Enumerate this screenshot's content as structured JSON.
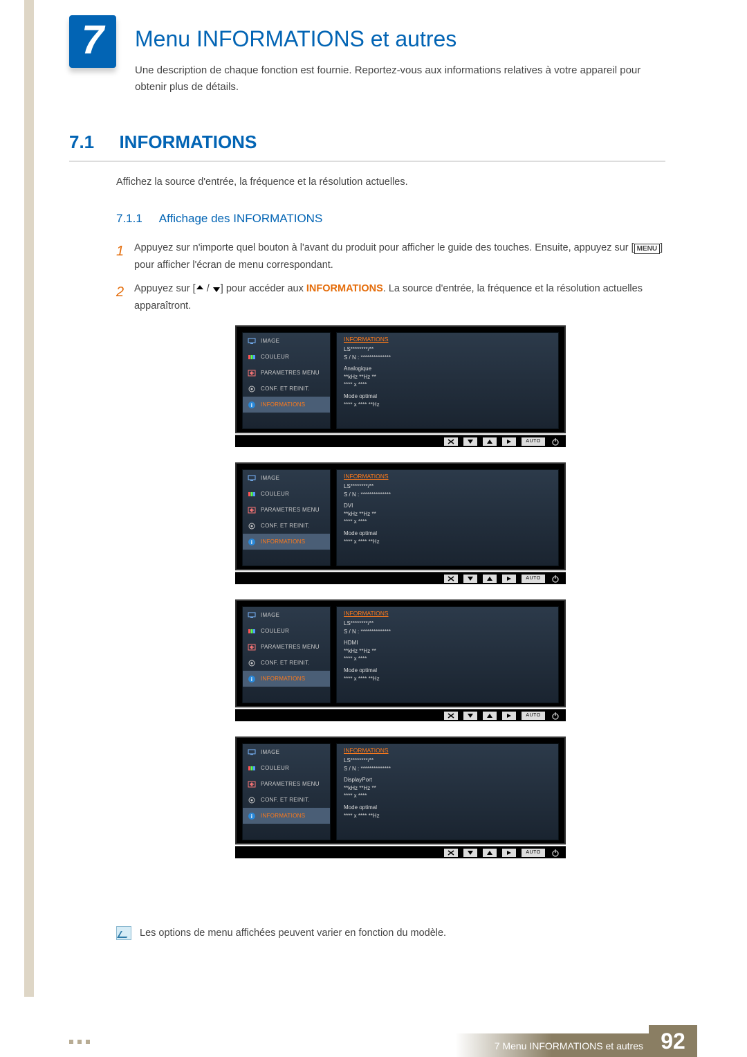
{
  "chapter": {
    "number": "7",
    "title": "Menu INFORMATIONS et autres",
    "description": "Une description de chaque fonction est fournie. Reportez-vous aux informations relatives à votre appareil pour obtenir plus de détails."
  },
  "section": {
    "number": "7.1",
    "title": "INFORMATIONS",
    "text": "Affichez la source d'entrée, la fréquence et la résolution actuelles."
  },
  "subsection": {
    "number": "7.1.1",
    "title": "Affichage des INFORMATIONS"
  },
  "steps": {
    "s1_num": "1",
    "s1_a": "Appuyez sur n'importe quel bouton à l'avant du produit pour afficher le guide des touches. Ensuite, appuyez sur [",
    "s1_menu": "MENU",
    "s1_b": "] pour afficher l'écran de menu correspondant.",
    "s2_num": "2",
    "s2_a": "Appuyez sur [",
    "s2_b": "] pour accéder aux ",
    "s2_hl": "INFORMATIONS",
    "s2_c": ". La source d'entrée, la fréquence et la résolution actuelles apparaîtront."
  },
  "osd_menu": {
    "items": [
      "IMAGE",
      "COULEUR",
      "PARAMETRES MENU",
      "CONF. ET REINIT.",
      "INFORMATIONS"
    ],
    "selected_index": 4,
    "panel_title": "INFORMATIONS",
    "model": "LS********/**",
    "serial": "S / N : **************",
    "freq": "**kHz **Hz **",
    "res": "**** x ****",
    "optimal_label": "Mode optimal",
    "optimal_value": "**** x **** **Hz",
    "bar": {
      "auto": "AUTO"
    }
  },
  "osd_sources": [
    "Analogique",
    "DVI",
    "HDMI",
    "DisplayPort"
  ],
  "note": "Les options de menu affichées peuvent varier en fonction du modèle.",
  "footer": {
    "breadcrumb": "7 Menu INFORMATIONS et autres",
    "page": "92"
  }
}
